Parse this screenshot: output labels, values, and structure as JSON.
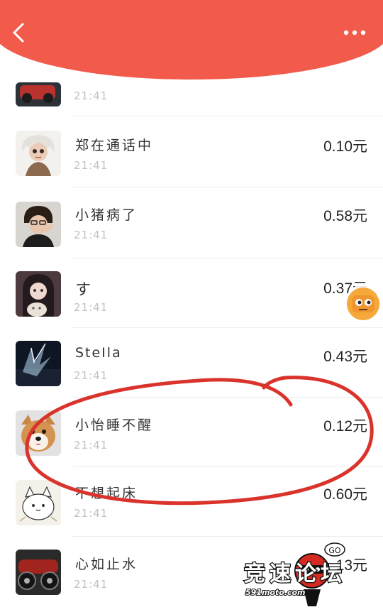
{
  "rows": [
    {
      "name": "",
      "time": "21:41",
      "amount": ""
    },
    {
      "name": "郑在通话中",
      "time": "21:41",
      "amount": "0.10元"
    },
    {
      "name": "小猪病了",
      "time": "21:41",
      "amount": "0.58元"
    },
    {
      "name": "す",
      "time": "21:41",
      "amount": "0.37元"
    },
    {
      "name": "SteIla",
      "time": "21:41",
      "amount": "0.43元"
    },
    {
      "name": "小怡睡不醒",
      "time": "21:41",
      "amount": "0.12元"
    },
    {
      "name": "不想起床",
      "time": "21:41",
      "amount": "0.60元"
    },
    {
      "name": "心如止水",
      "time": "21:41",
      "amount": "13元"
    }
  ],
  "watermark": {
    "title": "竞速论坛",
    "site": "591moto.com",
    "bubble": "GO"
  },
  "colors": {
    "header": "#f25a4c",
    "annotation": "#d9332c"
  }
}
